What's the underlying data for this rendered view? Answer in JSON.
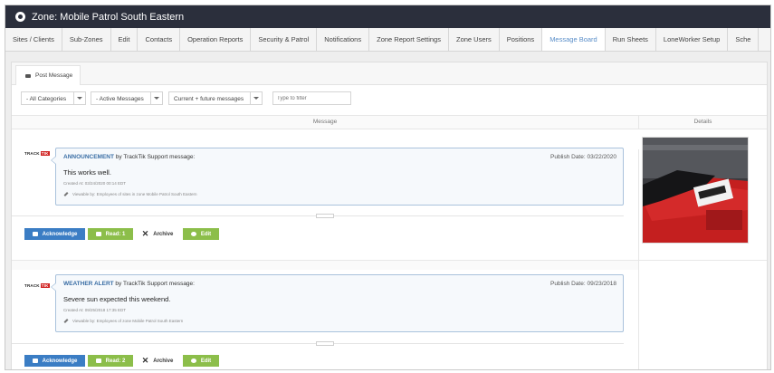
{
  "window": {
    "title": "Zone: Mobile Patrol South Eastern"
  },
  "tabs": [
    {
      "label": "Sites / Clients",
      "active": false
    },
    {
      "label": "Sub-Zones",
      "active": false
    },
    {
      "label": "Edit",
      "active": false
    },
    {
      "label": "Contacts",
      "active": false
    },
    {
      "label": "Operation Reports",
      "active": false
    },
    {
      "label": "Security & Patrol",
      "active": false
    },
    {
      "label": "Notifications",
      "active": false
    },
    {
      "label": "Zone Report Settings",
      "active": false
    },
    {
      "label": "Zone Users",
      "active": false
    },
    {
      "label": "Positions",
      "active": false
    },
    {
      "label": "Message Board",
      "active": true
    },
    {
      "label": "Run Sheets",
      "active": false
    },
    {
      "label": "LoneWorker Setup",
      "active": false
    },
    {
      "label": "Sche",
      "active": false
    }
  ],
  "panel": {
    "post_tab_label": "Post Message"
  },
  "filters": {
    "category": "- All Categories",
    "status": "- Active Messages",
    "period": "Current + future messages",
    "search_placeholder": "Type to filter"
  },
  "columns": {
    "message": "Message",
    "details": "Details"
  },
  "messages": [
    {
      "logo_text": "TRACK",
      "logo_accent": "TIK",
      "kind": "ANNOUNCEMENT",
      "by": "by TrackTik Support message:",
      "publish": "Publish Date: 03/22/2020",
      "body": "This works well.",
      "created": "Created At: 03/24/2020 00:14 EDT",
      "viewable": "Viewable by: Employees of sites in zone Mobile Patrol South Eastern",
      "actions": {
        "acknowledge": "Acknowledge",
        "read": "Read: 1",
        "archive": "Archive",
        "edit": "Edit"
      }
    },
    {
      "logo_text": "TRACK",
      "logo_accent": "TIK",
      "kind": "WEATHER ALERT",
      "by": "by TrackTik Support message:",
      "publish": "Publish Date: 09/23/2018",
      "body": "Severe sun expected this weekend.",
      "created": "Created At: 09/25/2018 17:35 EDT",
      "viewable": "Viewable by: Employees of zone Mobile Patrol South Eastern",
      "actions": {
        "acknowledge": "Acknowledge",
        "read": "Read: 2",
        "archive": "Archive",
        "edit": "Edit"
      }
    }
  ],
  "colors": {
    "titlebar": "#2b2f3c",
    "accent_blue": "#3b7dc4",
    "accent_green": "#8cbe4a",
    "active_tab_text": "#5b8fc9"
  }
}
